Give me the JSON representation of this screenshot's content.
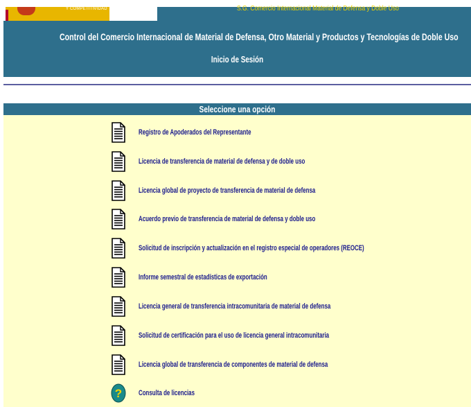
{
  "header": {
    "ministry_text": "Y COMPETITIVIDAD",
    "subdirectorate": "S.G. Comercio Internacional Material de Defensa y Doble Uso",
    "title": "Control del Comercio Internacional de Material de Defensa, Otro Material y Productos y Tecnologías de Doble Uso",
    "login": "Inicio de Sesión"
  },
  "panel": {
    "title": "Seleccione una opción",
    "items": [
      {
        "label": "Registro de Apoderados del Representante",
        "icon": "document-icon"
      },
      {
        "label": "Licencia de transferencia de material de defensa y de doble uso",
        "icon": "document-icon"
      },
      {
        "label": "Licencia global de proyecto de transferencia de material de defensa",
        "icon": "document-icon"
      },
      {
        "label": "Acuerdo previo de transferencia de material de defensa y doble uso",
        "icon": "document-icon"
      },
      {
        "label": "Solicitud de inscripción y actualización en el registro especial de operadores (REOCE)",
        "icon": "document-icon"
      },
      {
        "label": "Informe semestral de estadísticas de exportación",
        "icon": "document-icon"
      },
      {
        "label": "Licencia general de transferencia intracomunitaria de material de defensa",
        "icon": "document-icon"
      },
      {
        "label": "Solicitud de certificación para el uso de licencia general intracomunitaria",
        "icon": "document-icon"
      },
      {
        "label": "Licencia global de transferencia de componentes de material de defensa",
        "icon": "document-icon"
      },
      {
        "label": "Consulta de licencias",
        "icon": "help-icon"
      }
    ]
  },
  "colors": {
    "header_bg": "#2e6f8c",
    "panel_bg": "#ffffcc",
    "link": "#1a1a8c"
  }
}
